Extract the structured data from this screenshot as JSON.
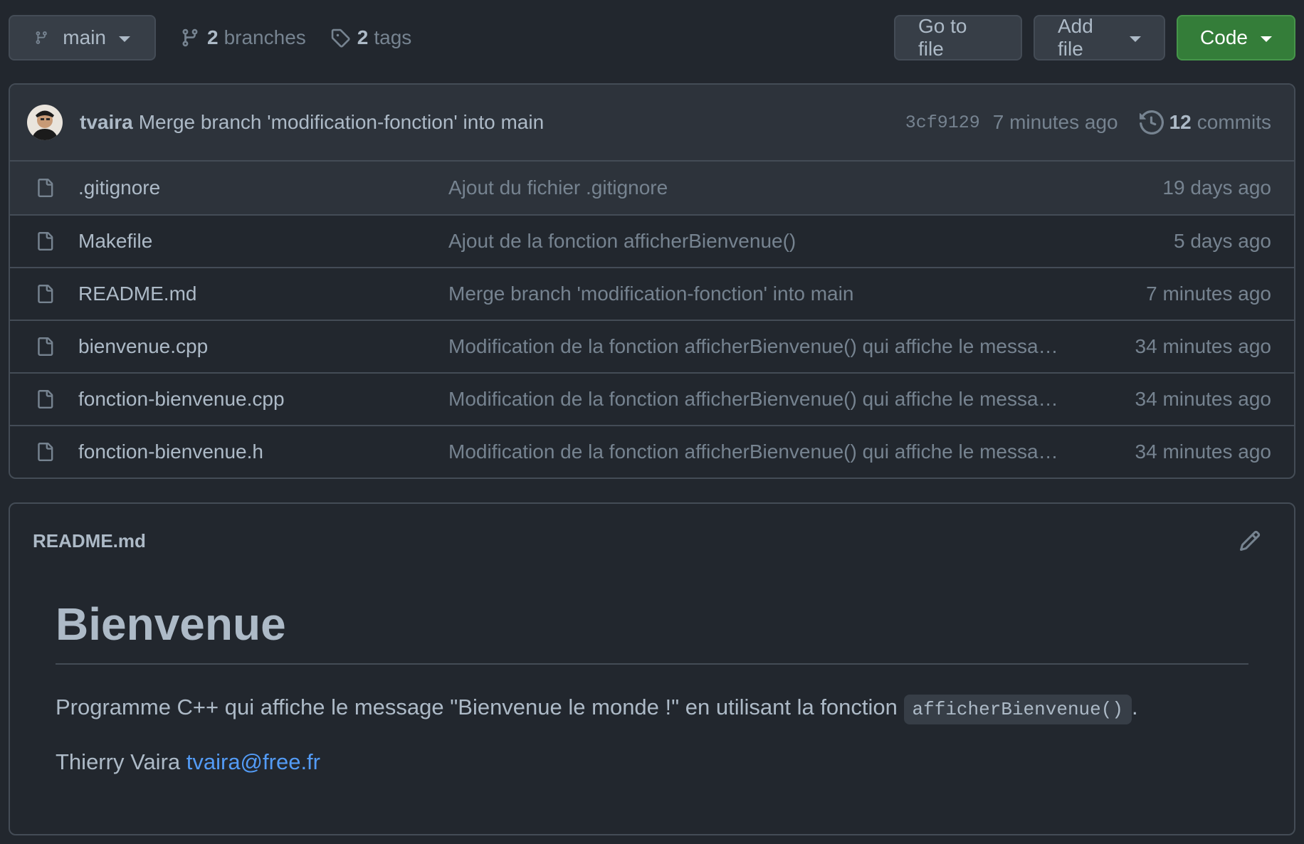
{
  "toolbar": {
    "branch": "main",
    "branches_count": "2",
    "branches_label": "branches",
    "tags_count": "2",
    "tags_label": "tags",
    "go_to_file": "Go to file",
    "add_file": "Add file",
    "code": "Code"
  },
  "commit": {
    "author": "tvaira",
    "message": "Merge branch 'modification-fonction' into main",
    "sha": "3cf9129",
    "time": "7 minutes ago",
    "commits_count": "12",
    "commits_label": "commits"
  },
  "files": [
    {
      "name": ".gitignore",
      "message": "Ajout du fichier .gitignore",
      "age": "19 days ago"
    },
    {
      "name": "Makefile",
      "message": "Ajout de la fonction afficherBienvenue()",
      "age": "5 days ago"
    },
    {
      "name": "README.md",
      "message": "Merge branch 'modification-fonction' into main",
      "age": "7 minutes ago"
    },
    {
      "name": "bienvenue.cpp",
      "message": "Modification de la fonction afficherBienvenue() qui affiche le messag…",
      "age": "34 minutes ago"
    },
    {
      "name": "fonction-bienvenue.cpp",
      "message": "Modification de la fonction afficherBienvenue() qui affiche le messag…",
      "age": "34 minutes ago"
    },
    {
      "name": "fonction-bienvenue.h",
      "message": "Modification de la fonction afficherBienvenue() qui affiche le messag…",
      "age": "34 minutes ago"
    }
  ],
  "readme": {
    "filename": "README.md",
    "heading": "Bienvenue",
    "paragraph_text": "Programme C++ qui affiche le message \"Bienvenue le monde !\" en utilisant la fonction ",
    "paragraph_code": "afficherBienvenue()",
    "paragraph_end": ".",
    "author_name": "Thierry Vaira ",
    "author_email": "tvaira@free.fr"
  },
  "colors": {
    "background": "#22272e",
    "border": "#444c56",
    "code_button": "#347d39",
    "link": "#539bf5"
  }
}
